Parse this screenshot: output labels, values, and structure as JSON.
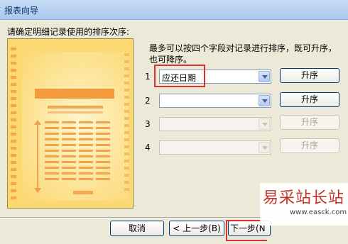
{
  "window": {
    "title": "报表向导"
  },
  "instruction": "请确定明细记录使用的排序次序:",
  "description": "最多可以按四个字段对记录进行排序，既可升序，也可降序。",
  "sort_rows": [
    {
      "index": "1",
      "field": "应还日期",
      "order": "升序",
      "enabled": true
    },
    {
      "index": "2",
      "field": "",
      "order": "升序",
      "enabled": true
    },
    {
      "index": "3",
      "field": "",
      "order": "升序",
      "enabled": false
    },
    {
      "index": "4",
      "field": "",
      "order": "升序",
      "enabled": false
    }
  ],
  "footer": {
    "cancel": "取消",
    "back": "< 上一步(B)",
    "next": "下一步(N"
  },
  "watermark": {
    "text": "易采站长站",
    "url": "www.easck.com"
  },
  "colors": {
    "highlight": "#d8322d",
    "illustration": "#fbd872",
    "accent": "#f39b3a"
  }
}
